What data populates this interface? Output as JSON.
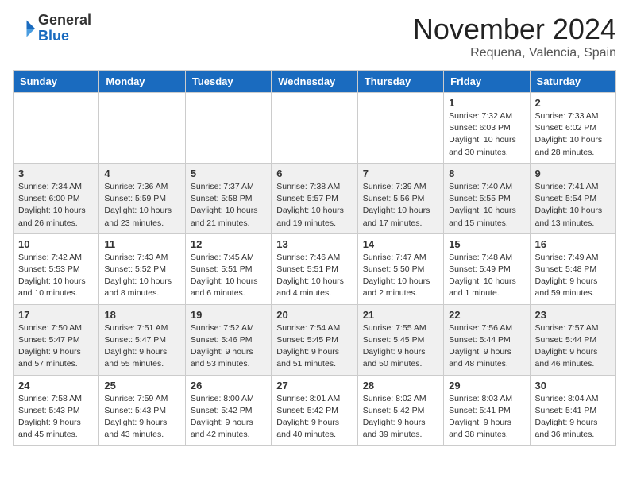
{
  "header": {
    "logo_general": "General",
    "logo_blue": "Blue",
    "month_title": "November 2024",
    "location": "Requena, Valencia, Spain"
  },
  "weekdays": [
    "Sunday",
    "Monday",
    "Tuesday",
    "Wednesday",
    "Thursday",
    "Friday",
    "Saturday"
  ],
  "weeks": [
    [
      {
        "day": "",
        "info": ""
      },
      {
        "day": "",
        "info": ""
      },
      {
        "day": "",
        "info": ""
      },
      {
        "day": "",
        "info": ""
      },
      {
        "day": "",
        "info": ""
      },
      {
        "day": "1",
        "info": "Sunrise: 7:32 AM\nSunset: 6:03 PM\nDaylight: 10 hours\nand 30 minutes."
      },
      {
        "day": "2",
        "info": "Sunrise: 7:33 AM\nSunset: 6:02 PM\nDaylight: 10 hours\nand 28 minutes."
      }
    ],
    [
      {
        "day": "3",
        "info": "Sunrise: 7:34 AM\nSunset: 6:00 PM\nDaylight: 10 hours\nand 26 minutes."
      },
      {
        "day": "4",
        "info": "Sunrise: 7:36 AM\nSunset: 5:59 PM\nDaylight: 10 hours\nand 23 minutes."
      },
      {
        "day": "5",
        "info": "Sunrise: 7:37 AM\nSunset: 5:58 PM\nDaylight: 10 hours\nand 21 minutes."
      },
      {
        "day": "6",
        "info": "Sunrise: 7:38 AM\nSunset: 5:57 PM\nDaylight: 10 hours\nand 19 minutes."
      },
      {
        "day": "7",
        "info": "Sunrise: 7:39 AM\nSunset: 5:56 PM\nDaylight: 10 hours\nand 17 minutes."
      },
      {
        "day": "8",
        "info": "Sunrise: 7:40 AM\nSunset: 5:55 PM\nDaylight: 10 hours\nand 15 minutes."
      },
      {
        "day": "9",
        "info": "Sunrise: 7:41 AM\nSunset: 5:54 PM\nDaylight: 10 hours\nand 13 minutes."
      }
    ],
    [
      {
        "day": "10",
        "info": "Sunrise: 7:42 AM\nSunset: 5:53 PM\nDaylight: 10 hours\nand 10 minutes."
      },
      {
        "day": "11",
        "info": "Sunrise: 7:43 AM\nSunset: 5:52 PM\nDaylight: 10 hours\nand 8 minutes."
      },
      {
        "day": "12",
        "info": "Sunrise: 7:45 AM\nSunset: 5:51 PM\nDaylight: 10 hours\nand 6 minutes."
      },
      {
        "day": "13",
        "info": "Sunrise: 7:46 AM\nSunset: 5:51 PM\nDaylight: 10 hours\nand 4 minutes."
      },
      {
        "day": "14",
        "info": "Sunrise: 7:47 AM\nSunset: 5:50 PM\nDaylight: 10 hours\nand 2 minutes."
      },
      {
        "day": "15",
        "info": "Sunrise: 7:48 AM\nSunset: 5:49 PM\nDaylight: 10 hours\nand 1 minute."
      },
      {
        "day": "16",
        "info": "Sunrise: 7:49 AM\nSunset: 5:48 PM\nDaylight: 9 hours\nand 59 minutes."
      }
    ],
    [
      {
        "day": "17",
        "info": "Sunrise: 7:50 AM\nSunset: 5:47 PM\nDaylight: 9 hours\nand 57 minutes."
      },
      {
        "day": "18",
        "info": "Sunrise: 7:51 AM\nSunset: 5:47 PM\nDaylight: 9 hours\nand 55 minutes."
      },
      {
        "day": "19",
        "info": "Sunrise: 7:52 AM\nSunset: 5:46 PM\nDaylight: 9 hours\nand 53 minutes."
      },
      {
        "day": "20",
        "info": "Sunrise: 7:54 AM\nSunset: 5:45 PM\nDaylight: 9 hours\nand 51 minutes."
      },
      {
        "day": "21",
        "info": "Sunrise: 7:55 AM\nSunset: 5:45 PM\nDaylight: 9 hours\nand 50 minutes."
      },
      {
        "day": "22",
        "info": "Sunrise: 7:56 AM\nSunset: 5:44 PM\nDaylight: 9 hours\nand 48 minutes."
      },
      {
        "day": "23",
        "info": "Sunrise: 7:57 AM\nSunset: 5:44 PM\nDaylight: 9 hours\nand 46 minutes."
      }
    ],
    [
      {
        "day": "24",
        "info": "Sunrise: 7:58 AM\nSunset: 5:43 PM\nDaylight: 9 hours\nand 45 minutes."
      },
      {
        "day": "25",
        "info": "Sunrise: 7:59 AM\nSunset: 5:43 PM\nDaylight: 9 hours\nand 43 minutes."
      },
      {
        "day": "26",
        "info": "Sunrise: 8:00 AM\nSunset: 5:42 PM\nDaylight: 9 hours\nand 42 minutes."
      },
      {
        "day": "27",
        "info": "Sunrise: 8:01 AM\nSunset: 5:42 PM\nDaylight: 9 hours\nand 40 minutes."
      },
      {
        "day": "28",
        "info": "Sunrise: 8:02 AM\nSunset: 5:42 PM\nDaylight: 9 hours\nand 39 minutes."
      },
      {
        "day": "29",
        "info": "Sunrise: 8:03 AM\nSunset: 5:41 PM\nDaylight: 9 hours\nand 38 minutes."
      },
      {
        "day": "30",
        "info": "Sunrise: 8:04 AM\nSunset: 5:41 PM\nDaylight: 9 hours\nand 36 minutes."
      }
    ]
  ]
}
